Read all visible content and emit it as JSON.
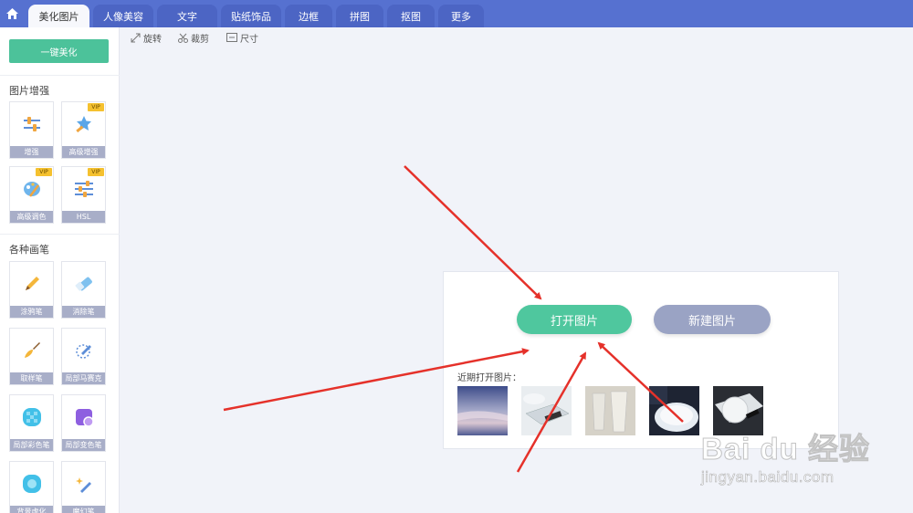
{
  "nav": {
    "tabs": [
      {
        "label": "美化图片",
        "active": true
      },
      {
        "label": "人像美容"
      },
      {
        "label": "文字"
      },
      {
        "label": "贴纸饰品"
      },
      {
        "label": "边框"
      },
      {
        "label": "拼图"
      },
      {
        "label": "抠图"
      },
      {
        "label": "更多"
      }
    ]
  },
  "sidebar": {
    "one_key": "一键美化",
    "enhance_title": "图片增强",
    "enhance_tools": [
      {
        "label": "增强",
        "vip": false,
        "icon": "sliders-icon"
      },
      {
        "label": "高级增强",
        "vip": true,
        "icon": "magic-wand-icon"
      },
      {
        "label": "高级调色",
        "vip": true,
        "icon": "palette-icon"
      },
      {
        "label": "HSL",
        "vip": true,
        "icon": "hsl-sliders-icon"
      }
    ],
    "brush_title": "各种画笔",
    "brush_tools": [
      {
        "label": "涂鸦笔",
        "icon": "pencil-icon"
      },
      {
        "label": "消除笔",
        "icon": "eraser-icon"
      },
      {
        "label": "取样笔",
        "icon": "sampling-brush-icon"
      },
      {
        "label": "局部马赛克",
        "icon": "mosaic-pen-icon"
      },
      {
        "label": "局部彩色笔",
        "icon": "color-blob-icon"
      },
      {
        "label": "局部变色笔",
        "icon": "color-change-icon"
      },
      {
        "label": "背景虚化",
        "icon": "blur-icon"
      },
      {
        "label": "魔幻笔",
        "icon": "magic-pen-icon"
      }
    ],
    "vip_badge": "VIP"
  },
  "toolbar": {
    "rotate": "旋转",
    "crop": "裁剪",
    "size": "尺寸"
  },
  "panel": {
    "open_label": "打开图片",
    "new_label": "新建图片",
    "recent_label": "近期打开图片：",
    "thumbnails": [
      "recent-photo-1",
      "recent-photo-2",
      "recent-photo-3",
      "recent-photo-4",
      "recent-photo-5"
    ]
  },
  "colors": {
    "nav_bg": "#5671d0",
    "accent_green": "#4fc79e",
    "secondary_button": "#9aa3c4",
    "arrow_red": "#e5312a"
  },
  "watermark": {
    "brand": "Bai du 经验",
    "url": "jingyan.baidu.com"
  }
}
